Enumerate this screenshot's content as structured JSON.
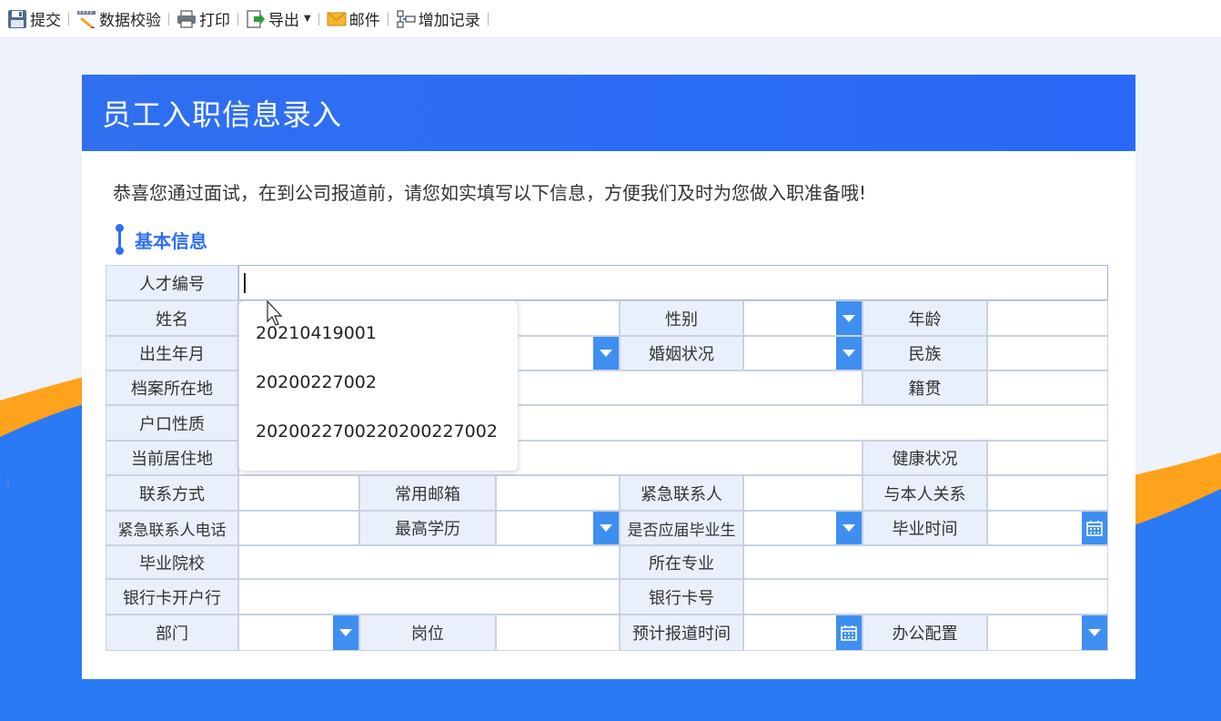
{
  "toolbar": {
    "submit": "提交",
    "validate": "数据校验",
    "print": "打印",
    "export": "导出",
    "mail": "邮件",
    "add_record": "增加记录"
  },
  "colors": {
    "primary": "#2f6ff0",
    "button": "#3f8ff0",
    "label_bg": "#eaf0fb",
    "accent_orange": "#ffa21c"
  },
  "page": {
    "title": "员工入职信息录入",
    "intro": "恭喜您通过面试，在到公司报道前，请您如实填写以下信息，方便我们及时为您做入职准备哦!",
    "section_title": "基本信息"
  },
  "labels": {
    "talent_no": "人才编号",
    "name": "姓名",
    "gender": "性别",
    "age": "年龄",
    "birth_month": "出生年月",
    "marital": "婚姻状况",
    "ethnicity": "民族",
    "archive_location": "档案所在地",
    "native_place": "籍贯",
    "household_type": "户口性质",
    "current_address": "当前居住地",
    "health": "健康状况",
    "contact": "联系方式",
    "email": "常用邮箱",
    "emergency_contact": "紧急联系人",
    "relationship": "与本人关系",
    "emergency_phone": "紧急联系人电话",
    "education": "最高学历",
    "fresh_grad": "是否应届毕业生",
    "grad_time": "毕业时间",
    "school": "毕业院校",
    "major": "所在专业",
    "bank": "银行卡开户行",
    "card_no": "银行卡号",
    "department": "部门",
    "position": "岗位",
    "report_time": "预计报道时间",
    "office_equipment": "办公配置"
  },
  "suggestions": [
    "20210419001",
    "20200227002",
    "2020022700220200227002"
  ]
}
